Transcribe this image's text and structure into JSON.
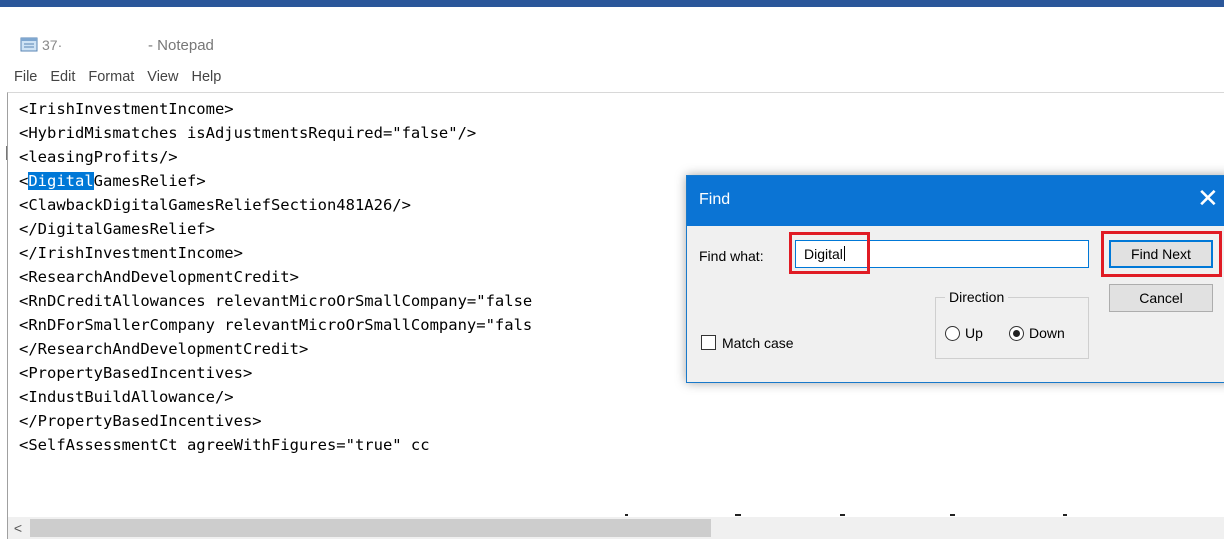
{
  "window": {
    "file_name": "37·",
    "app_title": "- Notepad"
  },
  "menu": [
    "File",
    "Edit",
    "Format",
    "View",
    "Help"
  ],
  "editor": {
    "lines": [
      {
        "before": "<IrishInvestmentIncome>",
        "sel": "",
        "after": ""
      },
      {
        "before": "<HybridMismatches isAdjustmentsRequired=\"false\"/>",
        "sel": "",
        "after": ""
      },
      {
        "before": "<leasingProfits/>",
        "sel": "",
        "after": ""
      },
      {
        "before": "<",
        "sel": "Digital",
        "after": "GamesRelief>"
      },
      {
        "before": "<ClawbackDigitalGamesReliefSection481A26/>",
        "sel": "",
        "after": ""
      },
      {
        "before": "</DigitalGamesRelief>",
        "sel": "",
        "after": ""
      },
      {
        "before": "</IrishInvestmentIncome>",
        "sel": "",
        "after": ""
      },
      {
        "before": "<ResearchAndDevelopmentCredit>",
        "sel": "",
        "after": ""
      },
      {
        "before": "<RnDCreditAllowances relevantMicroOrSmallCompany=\"false",
        "sel": "",
        "after": ""
      },
      {
        "before": "<RnDForSmallerCompany relevantMicroOrSmallCompany=\"fals",
        "sel": "",
        "after": ""
      },
      {
        "before": "</ResearchAndDevelopmentCredit>",
        "sel": "",
        "after": ""
      },
      {
        "before": "<PropertyBasedIncentives>",
        "sel": "",
        "after": ""
      },
      {
        "before": "<IndustBuildAllowance/>",
        "sel": "",
        "after": ""
      },
      {
        "before": "</PropertyBasedIncentives>",
        "sel": "",
        "after": ""
      },
      {
        "before": "<SelfAssessmentCt agreeWithFigures=\"true\" cc",
        "sel": "",
        "after": ""
      }
    ]
  },
  "find_dialog": {
    "title": "Find",
    "close_glyph": "✕",
    "find_what_label": "Find what:",
    "find_what_value": "Digital",
    "find_next_label": "Find Next",
    "cancel_label": "Cancel",
    "direction_label": "Direction",
    "up_label": "Up",
    "down_label": "Down",
    "selected_direction": "Down",
    "match_case_label": "Match case",
    "match_case_checked": false
  },
  "scrollbar": {
    "left_arrow": "<"
  },
  "colors": {
    "accent": "#0b74d4",
    "highlight_box": "#e01b24",
    "selection": "#0078d7"
  }
}
